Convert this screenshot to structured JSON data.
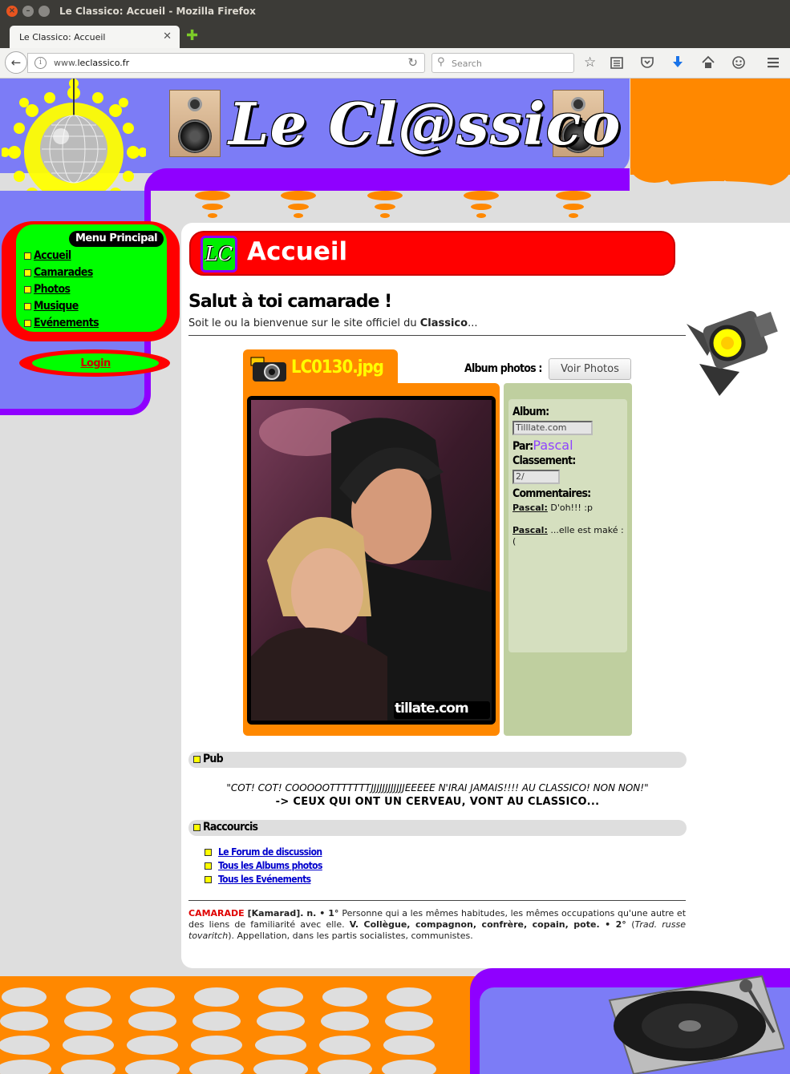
{
  "browser": {
    "window_title": "Le Classico: Accueil - Mozilla Firefox",
    "tab_title": "Le Classico: Accueil",
    "url_prefix": "www.",
    "url_domain": "leclassico.fr",
    "search_placeholder": "Search"
  },
  "header": {
    "site_title": "Le Cl@ssico"
  },
  "menu": {
    "title": "Menu Principal",
    "items": [
      {
        "label": "Accueil"
      },
      {
        "label": "Camarades"
      },
      {
        "label": "Photos"
      },
      {
        "label": "Musique"
      },
      {
        "label": "Evénements"
      }
    ],
    "login_label": "Login"
  },
  "page": {
    "logo_text": "LC",
    "heading": "Accueil",
    "welcome_title": "Salut à toi camarade !",
    "welcome_text_before": "Soit le ou la bienvenue sur le site officiel du ",
    "welcome_text_bold": "Classico",
    "welcome_text_after": "..."
  },
  "photo": {
    "filename": "LC0130.jpg",
    "album_photos_label": "Album photos :",
    "voir_button": "Voir Photos",
    "watermark": "tillate.com",
    "album_label": "Album:",
    "album_value": "Tilllate.com",
    "par_label": "Par:",
    "par_value": "Pascal",
    "classement_label": "Classement:",
    "classement_value": "2/",
    "comments_label": "Commentaires:",
    "comments": [
      {
        "author": "Pascal:",
        "text": " D'oh!!! :p"
      },
      {
        "author": "Pascal:",
        "text": " ...elle est maké :("
      }
    ]
  },
  "pub": {
    "title": "Pub",
    "quote": "\"COT! COT! COOOOOTTTTTTTJJJJJJJJJJJJEEEEE N'IRAI JAMAIS!!!! AU CLASSICO! NON NON!\"",
    "line2": "-> CEUX QUI ONT UN CERVEAU, VONT AU CLASSICO..."
  },
  "shortcuts": {
    "title": "Raccourcis",
    "items": [
      {
        "label": "Le Forum de discussion"
      },
      {
        "label": "Tous les Albums photos"
      },
      {
        "label": "Tous les Evénements"
      }
    ]
  },
  "definition": {
    "word": "CAMARADE",
    "pron": " [Kamarad]. ",
    "body_1": "n. • 1° ",
    "body_2": "Personne qui a les mêmes habitudes, les mêmes occupations qu'une autre et des liens de familiarité avec elle. ",
    "body_3": "V. Collègue, compagnon, confrère, copain, pote. • 2° ",
    "body_4": "(",
    "body_5": "Trad. russe tovaritch",
    "body_6": "). Appellation, dans les partis socialistes, communistes."
  },
  "colors": {
    "header_blue": "#7c7cf6",
    "purple": "#8f00ff",
    "orange": "#ff8800",
    "menu_red": "#ff0000",
    "menu_green": "#00ff00",
    "bullet_yellow": "#ffff00"
  },
  "icons": {
    "back": "back-arrow-icon",
    "info": "info-icon",
    "reload": "reload-icon",
    "search": "search-icon",
    "bookmark_star": "star-icon",
    "reading_list": "reading-list-icon",
    "pocket": "pocket-icon",
    "download": "download-icon",
    "home": "home-icon",
    "hello": "hello-icon",
    "menu": "hamburger-menu-icon"
  }
}
